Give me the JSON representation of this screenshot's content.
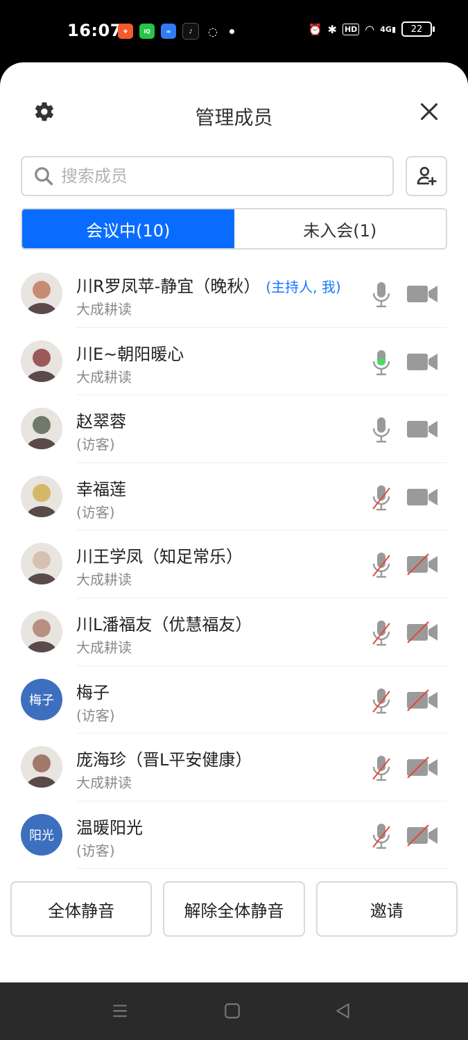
{
  "status_bar": {
    "time": "16:07",
    "battery": "22",
    "network": "4G",
    "hd": "HD"
  },
  "header": {
    "title": "管理成员"
  },
  "search": {
    "placeholder": "搜索成员"
  },
  "tabs": [
    {
      "label": "会议中(10)",
      "active": true
    },
    {
      "label": "未入会(1)",
      "active": false
    }
  ],
  "members": [
    {
      "name": "川R罗凤苹-静宜（晚秋）",
      "role": "(主持人, 我)",
      "sub": "大成耕读",
      "avatar_text": "",
      "mic": "on",
      "cam": "on"
    },
    {
      "name": "川E~朝阳暖心",
      "role": "",
      "sub": "大成耕读",
      "avatar_text": "",
      "mic": "speaking",
      "cam": "on"
    },
    {
      "name": "赵翠蓉",
      "role": "",
      "sub": "(访客)",
      "avatar_text": "",
      "mic": "on",
      "cam": "on"
    },
    {
      "name": "幸福莲",
      "role": "",
      "sub": "(访客)",
      "avatar_text": "",
      "mic": "off",
      "cam": "on"
    },
    {
      "name": "川王学凤（知足常乐）",
      "role": "",
      "sub": "大成耕读",
      "avatar_text": "",
      "mic": "off",
      "cam": "off"
    },
    {
      "name": "川L潘福友（优慧福友）",
      "role": "",
      "sub": "大成耕读",
      "avatar_text": "",
      "mic": "off",
      "cam": "off"
    },
    {
      "name": "梅子",
      "role": "",
      "sub": "(访客)",
      "avatar_text": "梅子",
      "mic": "off",
      "cam": "off"
    },
    {
      "name": "庞海珍（晋L平安健康）",
      "role": "",
      "sub": "大成耕读",
      "avatar_text": "",
      "mic": "off",
      "cam": "off"
    },
    {
      "name": "温暖阳光",
      "role": "",
      "sub": "(访客)",
      "avatar_text": "阳光",
      "mic": "off",
      "cam": "off"
    }
  ],
  "actions": {
    "mute_all": "全体静音",
    "unmute_all": "解除全体静音",
    "invite": "邀请"
  },
  "colors": {
    "accent": "#0a6cff",
    "host_tag": "#1677ff",
    "speaking": "#4cd964",
    "muted_slash": "#e24a3b",
    "icon_gray": "#9a9a9a"
  }
}
